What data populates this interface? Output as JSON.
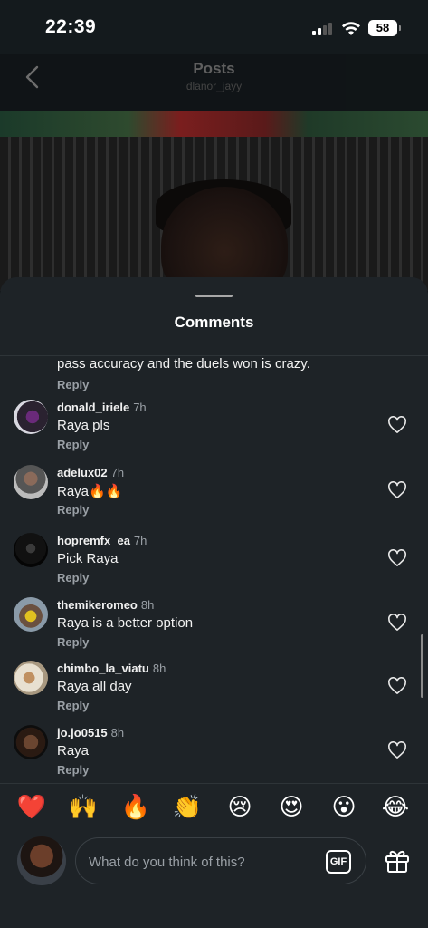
{
  "status_bar": {
    "time": "22:39",
    "battery": "58"
  },
  "header": {
    "title": "Posts",
    "subtitle": "dlanor_jayy"
  },
  "sheet": {
    "title": "Comments"
  },
  "partial_comment": {
    "text": "pass accuracy and the duels won is crazy.",
    "reply_label": "Reply"
  },
  "comments": [
    {
      "username": "donald_iriele",
      "time": "7h",
      "text": "Raya pls",
      "reply_label": "Reply"
    },
    {
      "username": "adelux02",
      "time": "7h",
      "text": "Raya🔥🔥",
      "reply_label": "Reply"
    },
    {
      "username": "hopremfx_ea",
      "time": "7h",
      "text": "Pick Raya",
      "reply_label": "Reply"
    },
    {
      "username": "themikeromeo",
      "time": "8h",
      "text": "Raya is a better option",
      "reply_label": "Reply"
    },
    {
      "username": "chimbo_la_viatu",
      "time": "8h",
      "text": "Raya all day",
      "reply_label": "Reply"
    },
    {
      "username": "jo.jo0515",
      "time": "8h",
      "text": "Raya",
      "reply_label": "Reply"
    }
  ],
  "reactions": [
    "❤️",
    "🙌",
    "🔥",
    "👏",
    "😢",
    "😍",
    "😮",
    "😂"
  ],
  "input": {
    "placeholder": "What do you think of this?",
    "gif_label": "GIF"
  },
  "icons": {
    "back": "chevron-left-icon",
    "like": "heart-outline-icon",
    "gift": "gift-icon"
  }
}
